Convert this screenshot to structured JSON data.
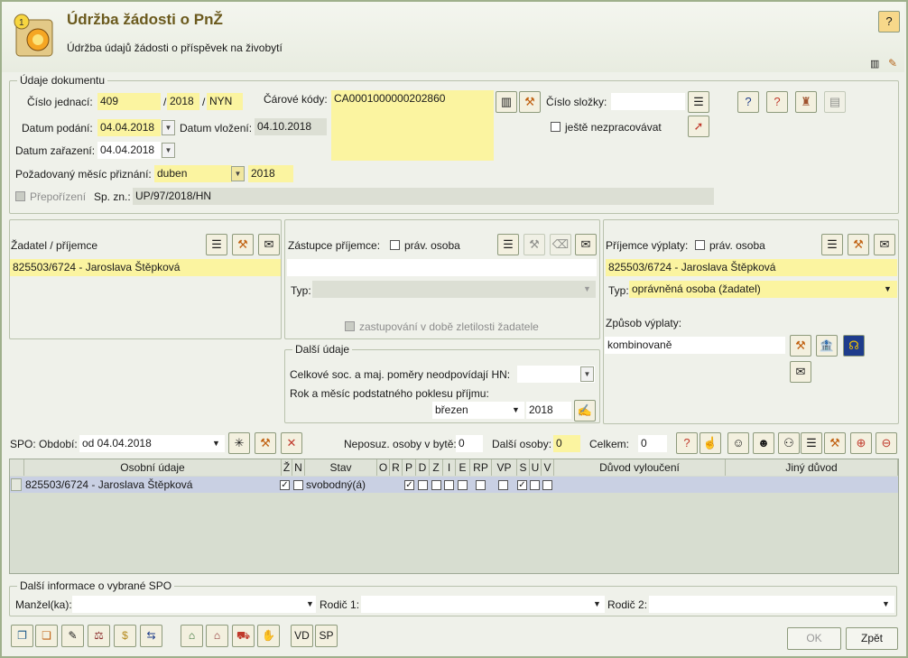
{
  "header": {
    "title": "Údržba žádosti o PnŽ",
    "subtitle": "Údržba údajů žádosti o příspěvek na živobytí"
  },
  "doc": {
    "legend": "Údaje dokumentu",
    "cislo_jednaci_label": "Číslo jednací:",
    "cj1": "409",
    "sep1": "/",
    "cj2": "2018",
    "sep2": "/",
    "cj3": "NYN",
    "carove_kody_label": "Čárové kódy:",
    "carovy_kod": "CA0001000000202860",
    "cislo_slozky_label": "Číslo složky:",
    "cislo_slozky": "",
    "datum_podani_label": "Datum podání:",
    "datum_podani": "04.04.2018",
    "datum_vlozeni_label": "Datum vložení:",
    "datum_vlozeni": "04.10.2018",
    "nezpracovavat_label": "ještě nezpracovávat",
    "datum_zarazeni_label": "Datum zařazení:",
    "datum_zarazeni": "04.04.2018",
    "mesic_label": "Požadovaný měsíc přiznání:",
    "mesic": "duben",
    "rok": "2018",
    "preposouzeni_label": "Přepořízení",
    "spzn_label": "Sp. zn.:",
    "spzn": "UP/97/2018/HN"
  },
  "zadatel": {
    "label": "Žadatel / příjemce",
    "value": "825503/6724 - Jaroslava Štěpková"
  },
  "zastupce": {
    "label": "Zástupce příjemce:",
    "prav_osoba": "práv. osoba",
    "value": "",
    "typ_label": "Typ:",
    "typ": "",
    "zastupovani": "zastupování v době zletilosti žadatele"
  },
  "dalsi": {
    "legend": "Další údaje",
    "celkove_label": "Celkové soc. a maj. poměry neodpovídají HN:",
    "celkove": "",
    "rok_mesic_label": "Rok a měsíc podstatného poklesu příjmu:",
    "mesic": "březen",
    "rok": "2018"
  },
  "prijemce": {
    "label": "Příjemce výplaty:",
    "prav_osoba": "práv. osoba",
    "value": "825503/6724 - Jaroslava Štěpková",
    "typ_label": "Typ:",
    "typ": "oprávněná osoba (žadatel)",
    "zpusob_label": "Způsob výplaty:",
    "zpusob": "kombinovaně"
  },
  "spo": {
    "label": "SPO: Období:",
    "obdobi": "od 04.04.2018",
    "neposuz_label": "Neposuz. osoby v bytě:",
    "neposuz": "0",
    "dalsi_label": "Další osoby:",
    "dalsi": "0",
    "celkem_label": "Celkem:",
    "celkem": "0"
  },
  "grid": {
    "headers": [
      "Osobní údaje",
      "Ž",
      "N",
      "Stav",
      "O",
      "R",
      "P",
      "D",
      "Z",
      "I",
      "E",
      "RP",
      "VP",
      "S",
      "U",
      "V",
      "Důvod vyloučení",
      "Jiný důvod"
    ],
    "row": {
      "osoba": "825503/6724 - Jaroslava Štěpková",
      "stav": "svobodný(á)",
      "zadatel": true,
      "n": false,
      "p": true,
      "s": true
    }
  },
  "info": {
    "legend": "Další informace o vybrané SPO",
    "manzel_label": "Manžel(ka):",
    "rodic1_label": "Rodič 1:",
    "rodic2_label": "Rodič 2:"
  },
  "bottom": {
    "vd": "VD",
    "sp": "SP",
    "ok": "OK",
    "zpet": "Zpět"
  }
}
